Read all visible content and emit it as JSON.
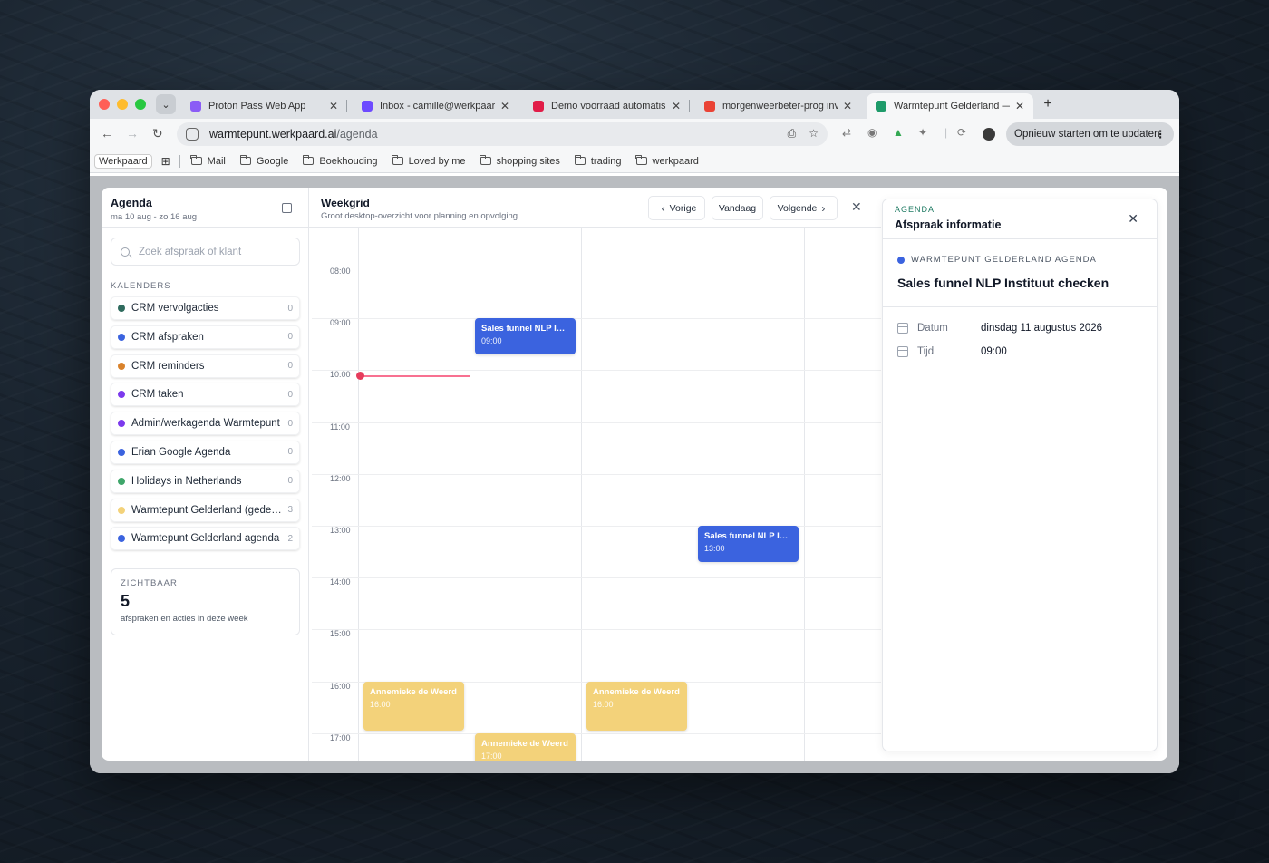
{
  "browser": {
    "tabs": [
      {
        "title": "Proton Pass Web App",
        "favicon_color": "#8b5cf6",
        "active": false
      },
      {
        "title": "Inbox - camille@werkpaard.ai",
        "favicon_color": "#6d4aff",
        "active": false
      },
      {
        "title": "Demo voorraad automatisering",
        "favicon_color": "#e11d48",
        "active": false
      },
      {
        "title": "morgenweerbeter-prog invite",
        "favicon_color": "#ea4335",
        "active": false
      },
      {
        "title": "Warmtepunt Gelderland — CRM",
        "favicon_color": "#1e9b6a",
        "active": true
      }
    ],
    "url_host": "warmtepunt.werkpaard.ai",
    "url_path": "/agenda",
    "update_button": "Opnieuw starten om te updaten",
    "bookmarks": {
      "first": "Werkpaard",
      "folders": [
        "Mail",
        "Google",
        "Boekhouding",
        "Loved by me",
        "shopping sites",
        "trading",
        "werkpaard"
      ]
    }
  },
  "sidebar": {
    "title": "Agenda",
    "subtitle": "ma 10 aug - zo 16 aug",
    "search_placeholder": "Zoek afspraak of klant",
    "calendars_heading": "KALENDERS",
    "calendars": [
      {
        "name": "CRM vervolgacties",
        "count": "0",
        "color": "#2f6b5e"
      },
      {
        "name": "CRM afspraken",
        "count": "0",
        "color": "#3b63df"
      },
      {
        "name": "CRM reminders",
        "count": "0",
        "color": "#d9822b"
      },
      {
        "name": "CRM taken",
        "count": "0",
        "color": "#7c3aed"
      },
      {
        "name": "Admin/werkagenda Warmtepunt",
        "count": "0",
        "color": "#7c3aed"
      },
      {
        "name": "Erian Google Agenda",
        "count": "0",
        "color": "#3b63df"
      },
      {
        "name": "Holidays in Netherlands",
        "count": "0",
        "color": "#3fa66a"
      },
      {
        "name": "Warmtepunt Gelderland (gedeeld)",
        "count": "3",
        "color": "#f3d27a"
      },
      {
        "name": "Warmtepunt Gelderland agenda",
        "count": "2",
        "color": "#3b63df"
      }
    ],
    "stats": {
      "label": "ZICHTBAAR",
      "value": "5",
      "description": "afspraken en acties in deze week"
    }
  },
  "main": {
    "title": "Weekgrid",
    "subtitle": "Groot desktop-overzicht voor planning en opvolging",
    "prev_label": "Vorige",
    "today_label": "Vandaag",
    "next_label": "Volgende",
    "hours": [
      "08:00",
      "09:00",
      "10:00",
      "11:00",
      "12:00",
      "13:00",
      "14:00",
      "15:00",
      "16:00",
      "17:00"
    ],
    "events": [
      {
        "title": "Sales funnel NLP Instituut checken",
        "time": "09:00",
        "day": 1,
        "start": 9,
        "duration": 0.7,
        "color": "blue"
      },
      {
        "title": "Sales funnel NLP Instituut checken",
        "time": "13:00",
        "day": 3,
        "start": 13,
        "duration": 0.7,
        "color": "blue"
      },
      {
        "title": "Annemieke de Weerd",
        "time": "16:00",
        "day": 0,
        "start": 16,
        "duration": 0.95,
        "color": "yellow"
      },
      {
        "title": "Annemieke de Weerd",
        "time": "16:00",
        "day": 2,
        "start": 16,
        "duration": 0.95,
        "color": "yellow"
      },
      {
        "title": "Annemieke de Weerd",
        "time": "17:00",
        "day": 1,
        "start": 17,
        "duration": 0.95,
        "color": "yellow"
      }
    ],
    "now_hour": 10.1
  },
  "detail": {
    "eyebrow": "AGENDA",
    "title": "Afspraak informatie",
    "calendar_name": "WARMTEPUNT GELDERLAND AGENDA",
    "calendar_color": "#3b63df",
    "event_title": "Sales funnel NLP Instituut checken",
    "date_label": "Datum",
    "date_value": "dinsdag 11 augustus 2026",
    "time_label": "Tijd",
    "time_value": "09:00"
  }
}
